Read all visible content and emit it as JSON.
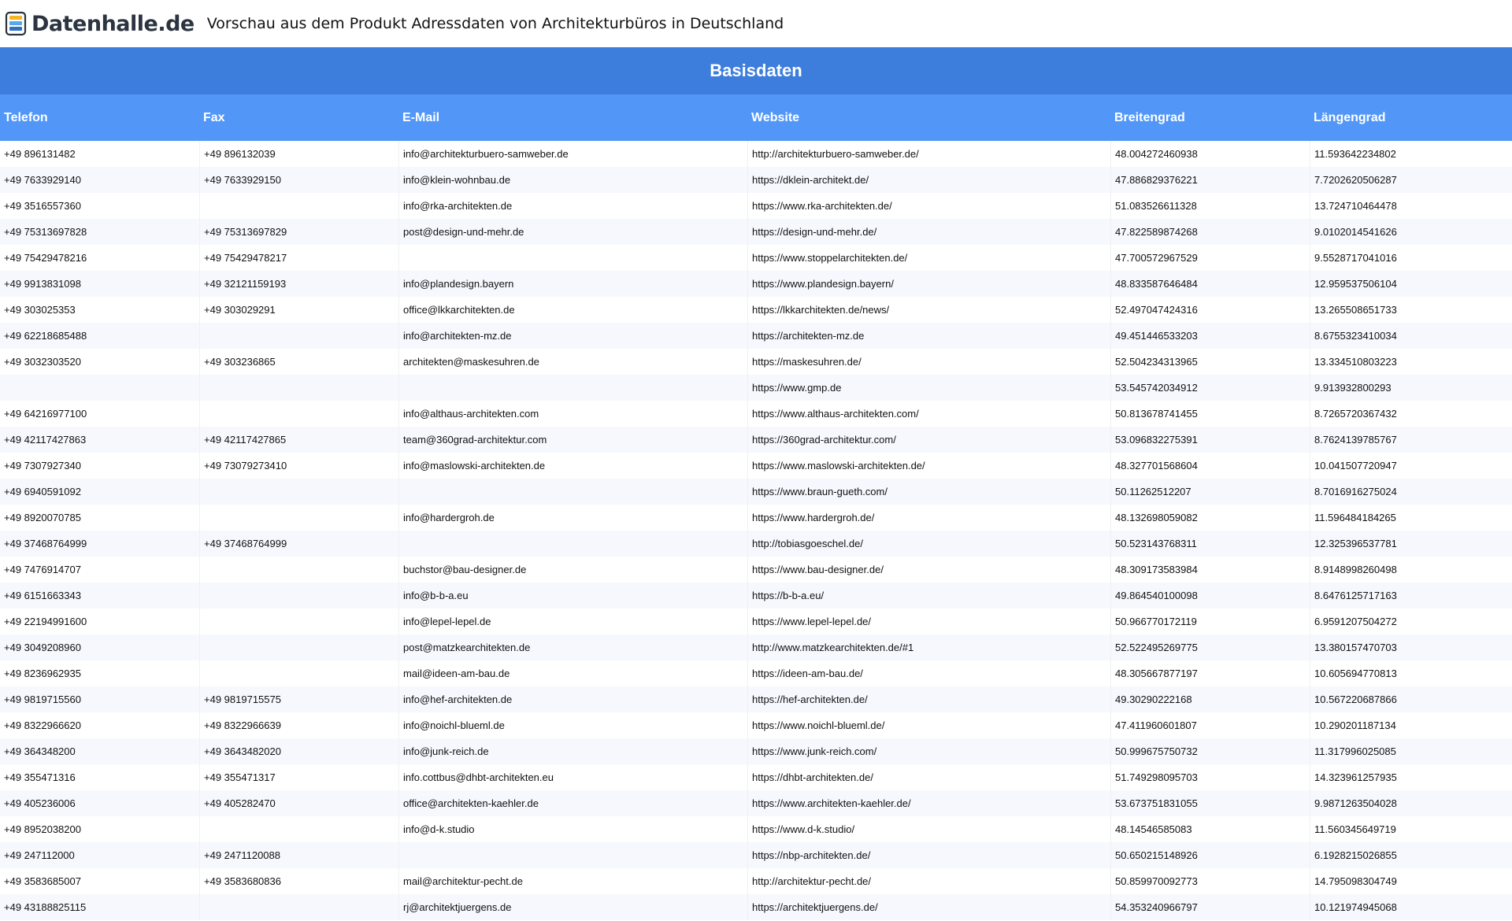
{
  "header": {
    "logo_text": "Datenhalle.de",
    "page_title": "Vorschau aus dem Produkt Adressdaten von Architekturbüros in Deutschland"
  },
  "table": {
    "section_title": "Basisdaten",
    "columns": [
      "Telefon",
      "Fax",
      "E-Mail",
      "Website",
      "Breitengrad",
      "Längengrad"
    ],
    "rows": [
      [
        "+49 896131482",
        "+49 896132039",
        "info@architekturbuero-samweber.de",
        "http://architekturbuero-samweber.de/",
        "48.004272460938",
        "11.593642234802"
      ],
      [
        "+49 7633929140",
        "+49 7633929150",
        "info@klein-wohnbau.de",
        "https://dklein-architekt.de/",
        "47.886829376221",
        "7.7202620506287"
      ],
      [
        "+49 3516557360",
        "",
        "info@rka-architekten.de",
        "https://www.rka-architekten.de/",
        "51.083526611328",
        "13.724710464478"
      ],
      [
        "+49 75313697828",
        "+49 75313697829",
        "post@design-und-mehr.de",
        "https://design-und-mehr.de/",
        "47.822589874268",
        "9.0102014541626"
      ],
      [
        "+49 75429478216",
        "+49 75429478217",
        "",
        "https://www.stoppelarchitekten.de/",
        "47.700572967529",
        "9.5528717041016"
      ],
      [
        "+49 9913831098",
        "+49 32121159193",
        "info@plandesign.bayern",
        "https://www.plandesign.bayern/",
        "48.833587646484",
        "12.959537506104"
      ],
      [
        "+49 303025353",
        "+49 303029291",
        "office@lkkarchitekten.de",
        "https://lkkarchitekten.de/news/",
        "52.497047424316",
        "13.265508651733"
      ],
      [
        "+49 62218685488",
        "",
        "info@architekten-mz.de",
        "https://architekten-mz.de",
        "49.451446533203",
        "8.6755323410034"
      ],
      [
        "+49 3032303520",
        "+49 303236865",
        "architekten@maskesuhren.de",
        "https://maskesuhren.de/",
        "52.504234313965",
        "13.334510803223"
      ],
      [
        "",
        "",
        "",
        "https://www.gmp.de",
        "53.545742034912",
        "9.913932800293"
      ],
      [
        "+49 64216977100",
        "",
        "info@althaus-architekten.com",
        "https://www.althaus-architekten.com/",
        "50.813678741455",
        "8.7265720367432"
      ],
      [
        "+49 42117427863",
        "+49 42117427865",
        "team@360grad-architektur.com",
        "https://360grad-architektur.com/",
        "53.096832275391",
        "8.7624139785767"
      ],
      [
        "+49 7307927340",
        "+49 73079273410",
        "info@maslowski-architekten.de",
        "https://www.maslowski-architekten.de/",
        "48.327701568604",
        "10.041507720947"
      ],
      [
        "+49 6940591092",
        "",
        "",
        "https://www.braun-gueth.com/",
        "50.11262512207",
        "8.7016916275024"
      ],
      [
        "+49 8920070785",
        "",
        "info@hardergroh.de",
        "https://www.hardergroh.de/",
        "48.132698059082",
        "11.596484184265"
      ],
      [
        "+49 37468764999",
        "+49 37468764999",
        "",
        "http://tobiasgoeschel.de/",
        "50.523143768311",
        "12.325396537781"
      ],
      [
        "+49 7476914707",
        "",
        "buchstor@bau-designer.de",
        "https://www.bau-designer.de/",
        "48.309173583984",
        "8.9148998260498"
      ],
      [
        "+49 6151663343",
        "",
        "info@b-b-a.eu",
        "https://b-b-a.eu/",
        "49.864540100098",
        "8.6476125717163"
      ],
      [
        "+49 22194991600",
        "",
        "info@lepel-lepel.de",
        "https://www.lepel-lepel.de/",
        "50.966770172119",
        "6.9591207504272"
      ],
      [
        "+49 3049208960",
        "",
        "post@matzkearchitekten.de",
        "http://www.matzkearchitekten.de/#1",
        "52.522495269775",
        "13.380157470703"
      ],
      [
        "+49 8236962935",
        "",
        "mail@ideen-am-bau.de",
        "https://ideen-am-bau.de/",
        "48.305667877197",
        "10.605694770813"
      ],
      [
        "+49 9819715560",
        "+49 9819715575",
        "info@hef-architekten.de",
        "https://hef-architekten.de/",
        "49.30290222168",
        "10.567220687866"
      ],
      [
        "+49 8322966620",
        "+49 8322966639",
        "info@noichl-blueml.de",
        "https://www.noichl-blueml.de/",
        "47.411960601807",
        "10.290201187134"
      ],
      [
        "+49 364348200",
        "+49 3643482020",
        "info@junk-reich.de",
        "https://www.junk-reich.com/",
        "50.999675750732",
        "11.317996025085"
      ],
      [
        "+49 355471316",
        "+49 355471317",
        "info.cottbus@dhbt-architekten.eu",
        "https://dhbt-architekten.de/",
        "51.749298095703",
        "14.323961257935"
      ],
      [
        "+49 405236006",
        "+49 405282470",
        "office@architekten-kaehler.de",
        "https://www.architekten-kaehler.de/",
        "53.673751831055",
        "9.9871263504028"
      ],
      [
        "+49 8952038200",
        "",
        "info@d-k.studio",
        "https://www.d-k.studio/",
        "48.14546585083",
        "11.560345649719"
      ],
      [
        "+49 247112000",
        "+49 2471120088",
        "",
        "https://nbp-architekten.de/",
        "50.650215148926",
        "6.1928215026855"
      ],
      [
        "+49 3583685007",
        "+49 3583680836",
        "mail@architektur-pecht.de",
        "http://architektur-pecht.de/",
        "50.859970092773",
        "14.795098304749"
      ],
      [
        "+49 43188825115",
        "",
        "rj@architektjuergens.de",
        "https://architektjuergens.de/",
        "54.353240966797",
        "10.121974945068"
      ]
    ]
  },
  "colors": {
    "section_header": "#3d7ddc",
    "column_header": "#5297f8",
    "row_alt": "#f6f8fe",
    "logo_text": "#2b3440"
  },
  "icons": {
    "logo": "database-stack-icon"
  }
}
